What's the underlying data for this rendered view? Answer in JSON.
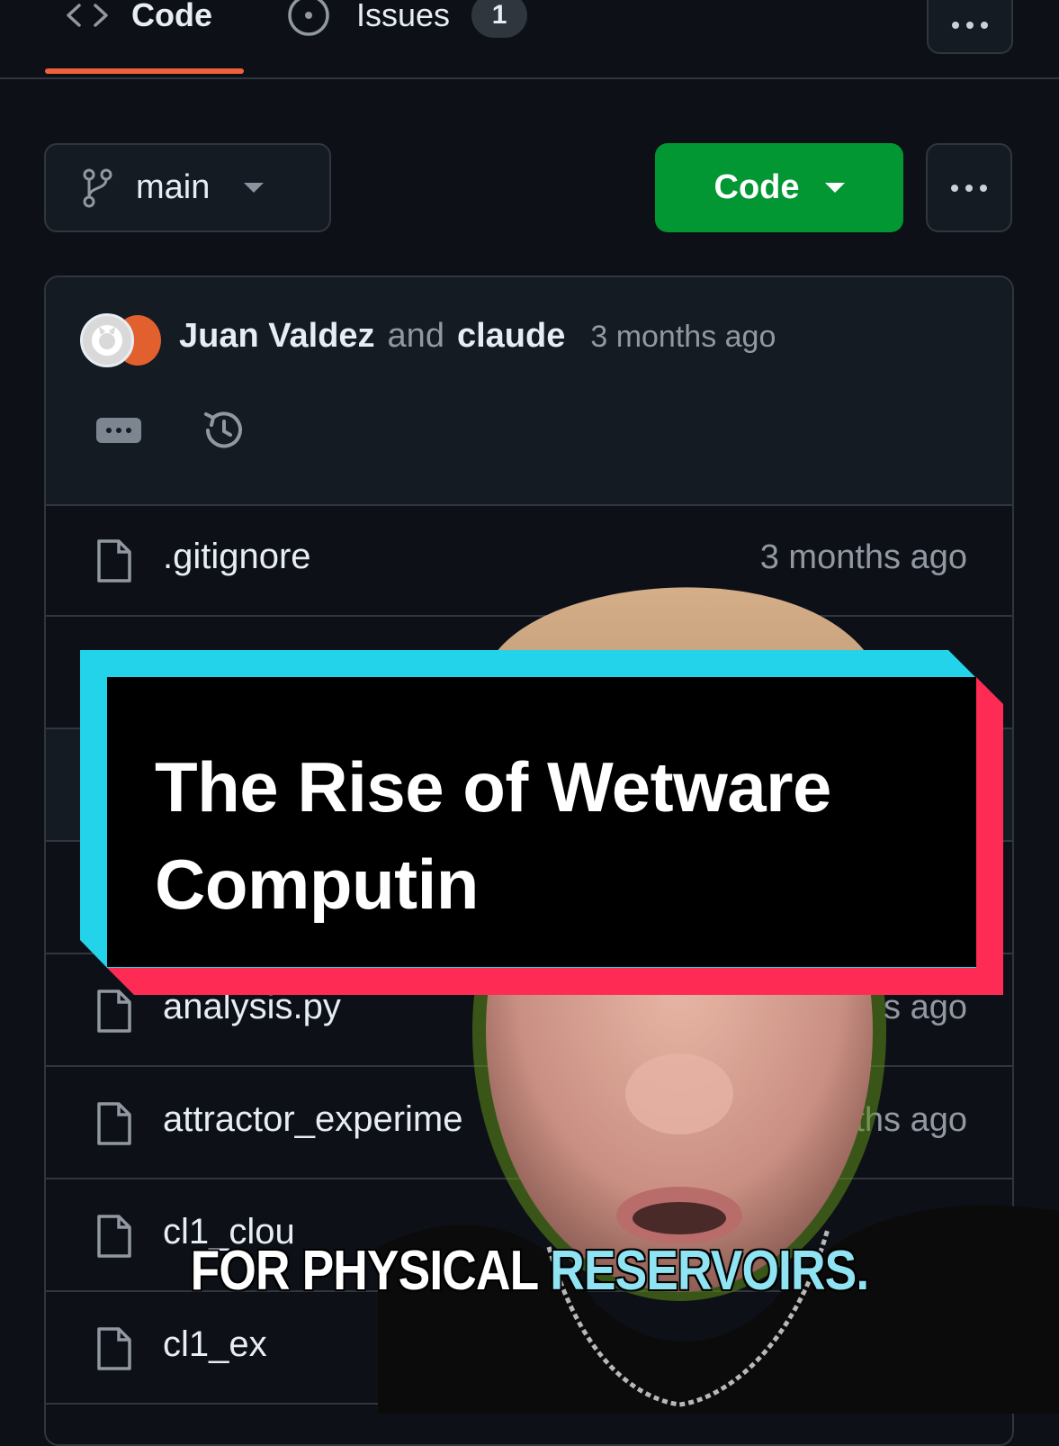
{
  "nav": {
    "code_label": "Code",
    "issues_label": "Issues",
    "issues_count": "1"
  },
  "branch": {
    "name": "main"
  },
  "code_button": {
    "label": "Code"
  },
  "commit": {
    "author1": "Juan Valdez",
    "joiner": "and",
    "author2": "claude",
    "time": "3 months ago"
  },
  "files": [
    {
      "name": ".gitignore",
      "time": "3 months ago"
    },
    {
      "name": "analysis.py",
      "time": "s ago"
    },
    {
      "name": "attractor_experime",
      "time": "ths ago"
    },
    {
      "name": "cl1_clou",
      "time": ""
    },
    {
      "name": "cl1_ex",
      "time": ""
    }
  ],
  "overlay": {
    "title_line1": "The Rise of Wetware",
    "title_line2": "Computin",
    "caption_part1": "FOR PHYSICAL",
    "caption_part2": "RESERVOIRS."
  },
  "colors": {
    "bg": "#0d1117",
    "accent_underline": "#f0633a",
    "code_button": "#029732",
    "card_cyan": "#22d3ea",
    "card_red": "#fe2c55",
    "caption_highlight": "#8fe3f2"
  }
}
